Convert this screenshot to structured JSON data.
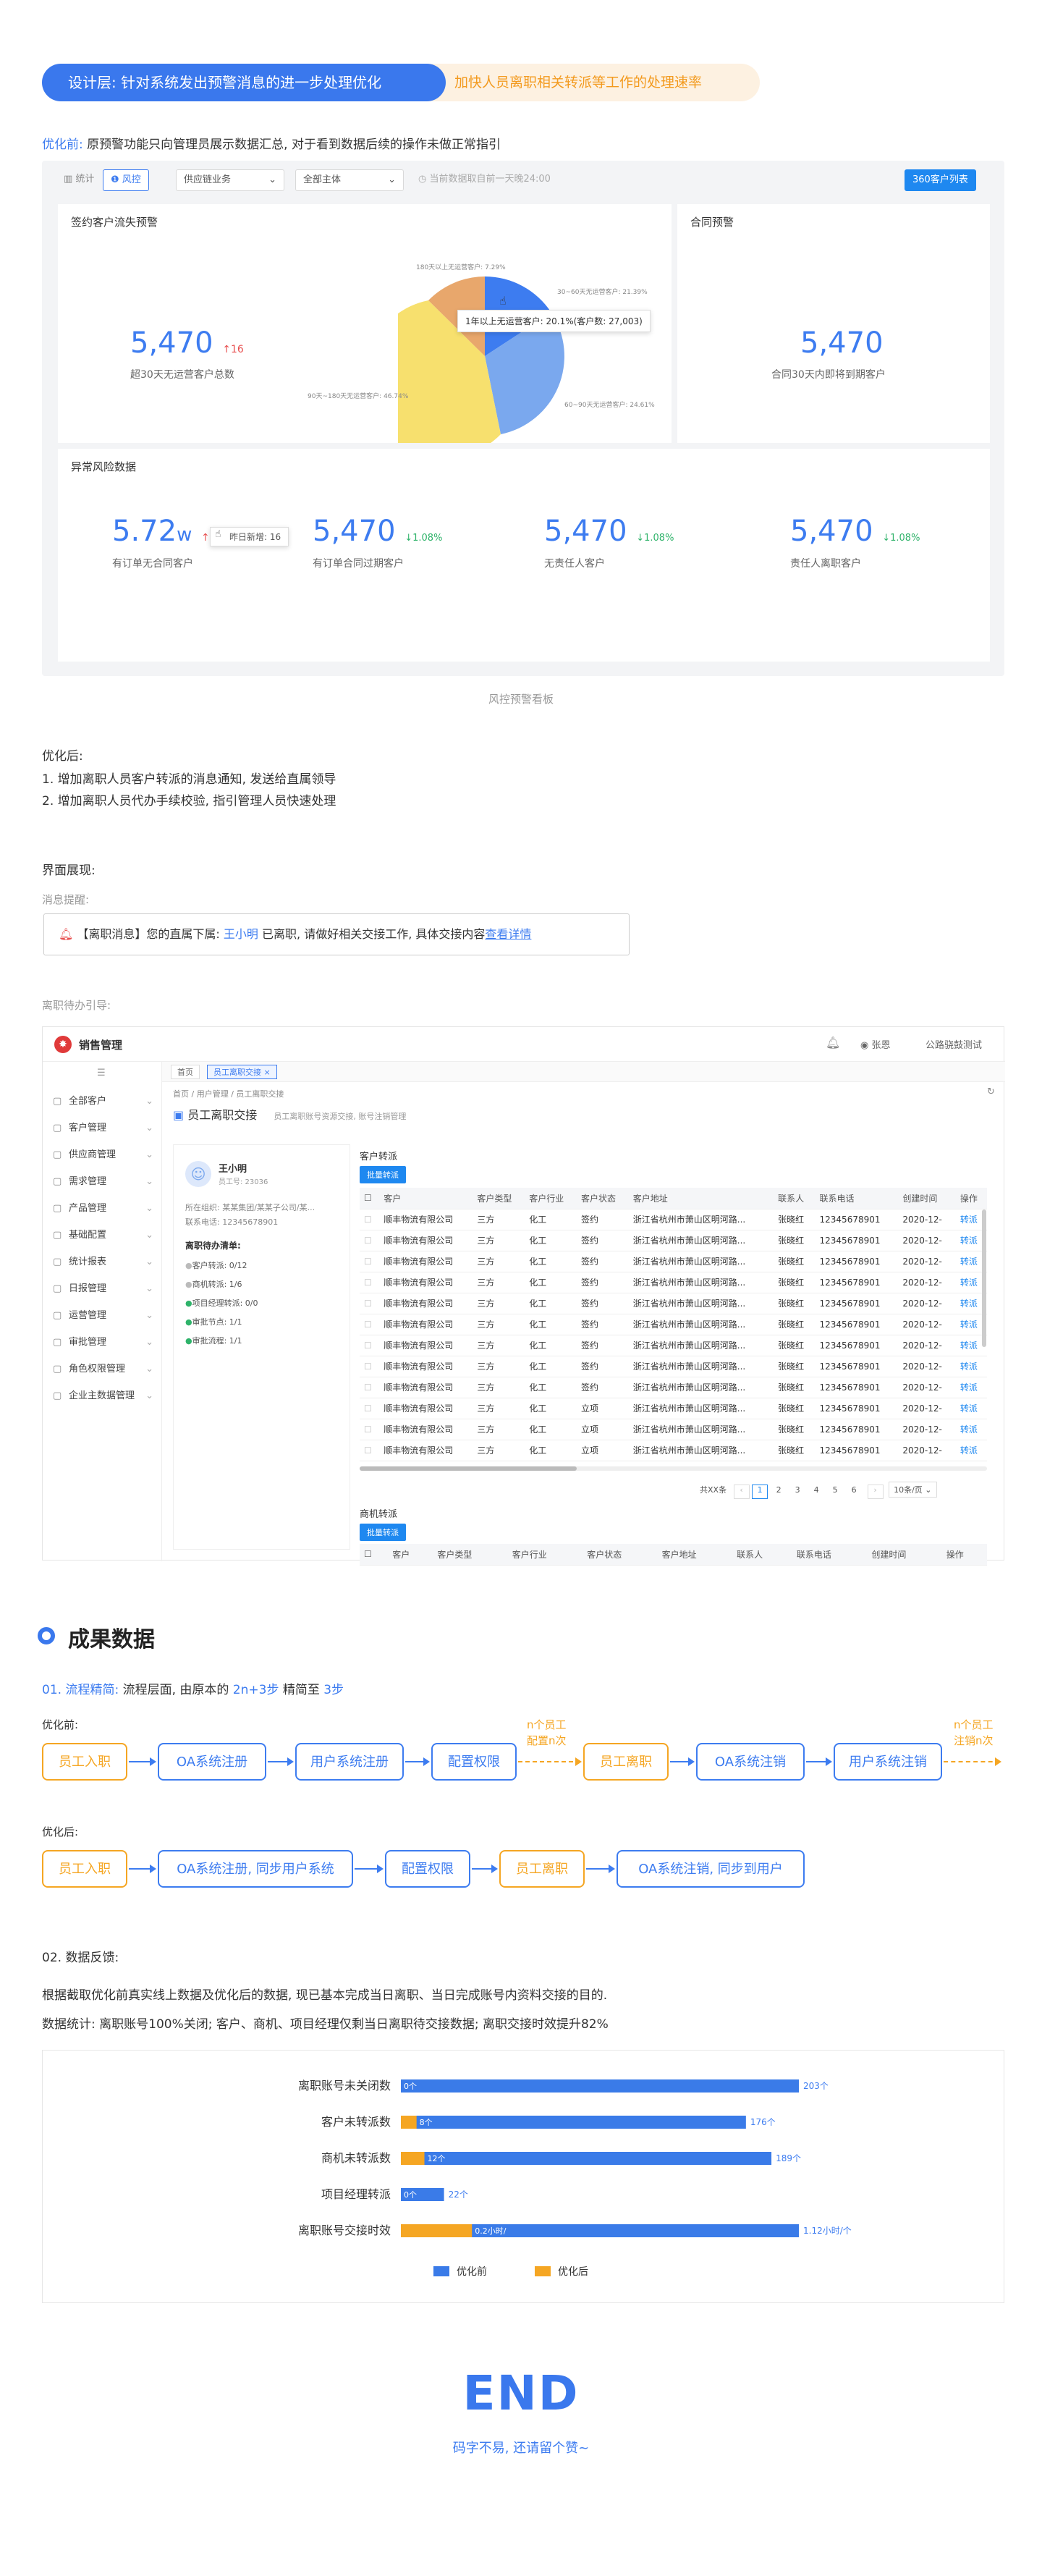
{
  "header": {
    "design_layer": "设计层: 针对系统发出预警消息的进一步处理优化",
    "goal": "加快人员离职相关转派等工作的处理速率"
  },
  "before": {
    "label": "优化前:",
    "text": "原预警功能只向管理员展示数据汇总, 对于看到数据后续的操作未做正常指引"
  },
  "dashboard": {
    "tab_stats": "统计",
    "tab_risk": "风控",
    "filter_business": "供应链业务",
    "filter_subject": "全部主体",
    "update_time": "当前数据取自前一天晚24:00",
    "btn_360": "360客户列表",
    "churn_title": "签约客户流失预警",
    "churn_value": "5,470",
    "churn_delta": "↑16",
    "churn_label": "超30天无运营客户总数",
    "contract_title": "合同预警",
    "contract_value": "5,470",
    "contract_label": "合同30天内即将到期客户",
    "risk_title": "异常风险数据",
    "pie_tooltip": "1年以上无运营客户: 20.1%(客户数: 27,003)",
    "pie_l1": "180天以上无运营客户: 7.29%",
    "pie_l2": "30~60天无运营客户: 21.39%",
    "pie_l3": "90天~180天无运营客户: 46.74%",
    "pie_l4": "60~90天无运营客户: 24.61%",
    "risk1_value": "5.72",
    "risk1_unit": "w",
    "risk1_delta": "↑16",
    "risk1_tip": "昨日新增: 16",
    "risk1_label": "有订单无合同客户",
    "risk2_value": "5,470",
    "risk2_delta": "↓1.08%",
    "risk2_label": "有订单合同过期客户",
    "risk3_value": "5,470",
    "risk3_delta": "↓1.08%",
    "risk3_label": "无责任人客户",
    "risk4_value": "5,470",
    "risk4_delta": "↓1.08%",
    "risk4_label": "责任人离职客户",
    "caption": "风控预警看板"
  },
  "after": {
    "title": "优化后:",
    "line1": "1. 增加离职人员客户转派的消息通知, 发送给直属领导",
    "line2": "2. 增加离职人员代办手续校验, 指引管理人员快速处理"
  },
  "ui_show": {
    "title": "界面展现:",
    "msg_label": "消息提醒:",
    "msg_prefix": "【离职消息】您的直属下属:",
    "msg_name": "王小明",
    "msg_mid": "已离职, 请做好相关交接工作, 具体交接内容",
    "msg_link": "查看详情",
    "todo_label": "离职待办引导:"
  },
  "app": {
    "brand": "销售管理",
    "user": "张恩",
    "company": "公路骁鼓测试",
    "tab_home": "首页",
    "tab_current": "员工离职交接",
    "breadcrumb": "首页 / 用户管理 / 员工离职交接",
    "page_title": "员工离职交接",
    "page_sub": "员工离职账号资源交接, 账号注销管理",
    "sidebar": [
      "全部客户",
      "客户管理",
      "供应商管理",
      "需求管理",
      "产品管理",
      "基础配置",
      "统计报表",
      "日报管理",
      "运营管理",
      "审批管理",
      "角色权限管理",
      "企业主数据管理"
    ],
    "emp_name": "王小明",
    "emp_no": "员工号: 23036",
    "emp_org": "所在组织: 某某集团/某某子公司/某...",
    "emp_phone": "联系电话: 12345678901",
    "todo_title": "离职待办清单:",
    "todos": [
      "客户转派: 0/12",
      "商机转派: 1/6",
      "项目经理转派: 0/0",
      "审批节点: 1/1",
      "审批流程: 1/1"
    ],
    "cust_section": "客户转派",
    "biz_section": "商机转派",
    "batch_btn": "批量转派",
    "columns": [
      "客户",
      "客户类型",
      "客户行业",
      "客户状态",
      "客户地址",
      "联系人",
      "联系电话",
      "创建时间",
      "操作"
    ],
    "rows": [
      [
        "顺丰物流有限公司",
        "三方",
        "化工",
        "签约",
        "浙江省杭州市萧山区明河路...",
        "张晓红",
        "12345678901",
        "2020-12-",
        "转派"
      ],
      [
        "顺丰物流有限公司",
        "三方",
        "化工",
        "签约",
        "浙江省杭州市萧山区明河路...",
        "张晓红",
        "12345678901",
        "2020-12-",
        "转派"
      ],
      [
        "顺丰物流有限公司",
        "三方",
        "化工",
        "签约",
        "浙江省杭州市萧山区明河路...",
        "张晓红",
        "12345678901",
        "2020-12-",
        "转派"
      ],
      [
        "顺丰物流有限公司",
        "三方",
        "化工",
        "签约",
        "浙江省杭州市萧山区明河路...",
        "张晓红",
        "12345678901",
        "2020-12-",
        "转派"
      ],
      [
        "顺丰物流有限公司",
        "三方",
        "化工",
        "签约",
        "浙江省杭州市萧山区明河路...",
        "张晓红",
        "12345678901",
        "2020-12-",
        "转派"
      ],
      [
        "顺丰物流有限公司",
        "三方",
        "化工",
        "签约",
        "浙江省杭州市萧山区明河路...",
        "张晓红",
        "12345678901",
        "2020-12-",
        "转派"
      ],
      [
        "顺丰物流有限公司",
        "三方",
        "化工",
        "签约",
        "浙江省杭州市萧山区明河路...",
        "张晓红",
        "12345678901",
        "2020-12-",
        "转派"
      ],
      [
        "顺丰物流有限公司",
        "三方",
        "化工",
        "签约",
        "浙江省杭州市萧山区明河路...",
        "张晓红",
        "12345678901",
        "2020-12-",
        "转派"
      ],
      [
        "顺丰物流有限公司",
        "三方",
        "化工",
        "签约",
        "浙江省杭州市萧山区明河路...",
        "张晓红",
        "12345678901",
        "2020-12-",
        "转派"
      ],
      [
        "顺丰物流有限公司",
        "三方",
        "化工",
        "立项",
        "浙江省杭州市萧山区明河路...",
        "张晓红",
        "12345678901",
        "2020-12-",
        "转派"
      ],
      [
        "顺丰物流有限公司",
        "三方",
        "化工",
        "立项",
        "浙江省杭州市萧山区明河路...",
        "张晓红",
        "12345678901",
        "2020-12-",
        "转派"
      ],
      [
        "顺丰物流有限公司",
        "三方",
        "化工",
        "立项",
        "浙江省杭州市萧山区明河路...",
        "张晓红",
        "12345678901",
        "2020-12-",
        "转派"
      ]
    ],
    "total": "共XX条",
    "pages": [
      "1",
      "2",
      "3",
      "4",
      "5",
      "6"
    ],
    "page_size": "10条/页"
  },
  "results": {
    "title": "成果数据",
    "s1_num": "01. 流程精简:",
    "s1_text": "流程层面, 由原本的",
    "s1_from": "2n+3步",
    "s1_mid": "精简至",
    "s1_to": "3步",
    "before_label": "优化前:",
    "after_label": "优化后:",
    "before_flow": [
      "员工入职",
      "OA系统注册",
      "用户系统注册",
      "配置权限",
      "员工离职",
      "OA系统注销",
      "用户系统注销"
    ],
    "before_note1": "n个员工\n配置n次",
    "before_note2": "n个员工\n注销n次",
    "after_flow": [
      "员工入职",
      "OA系统注册, 同步用户系统",
      "配置权限",
      "员工离职",
      "OA系统注销, 同步到用户"
    ],
    "s2_num": "02. 数据反馈:",
    "s2_text": "根据截取优化前真实线上数据及优化后的数据, 现已基本完成当日离职、当日完成账号内资料交接的目的.",
    "s2_stats": "数据统计: 离职账号100%关闭; 客户、商机、项目经理仅剩当日离职待交接数据; 离职交接时效提升82%"
  },
  "chart_data": {
    "type": "bar",
    "orientation": "horizontal",
    "categories": [
      "离职账号未关闭数",
      "客户未转派数",
      "商机未转派数",
      "项目经理转派",
      "离职账号交接时效"
    ],
    "series": [
      {
        "name": "优化前",
        "color": "#3a7be8",
        "values": [
          203,
          176,
          189,
          22,
          1.12
        ],
        "labels": [
          "203个",
          "176个",
          "189个",
          "22个",
          "1.12小时/个"
        ]
      },
      {
        "name": "优化后",
        "color": "#f5a623",
        "values": [
          0,
          8,
          12,
          0,
          0.2
        ],
        "labels": [
          "0个",
          "8个",
          "12个",
          "0个",
          "0.2小时/"
        ]
      }
    ]
  },
  "end": {
    "title": "END",
    "sub": "码字不易, 还请留个赞~"
  }
}
